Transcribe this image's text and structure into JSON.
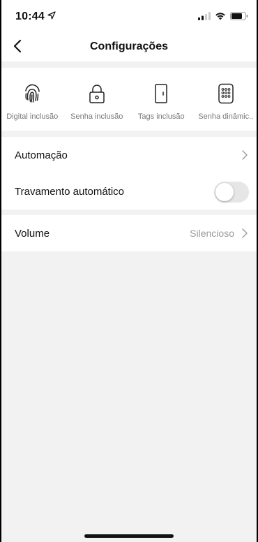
{
  "status_bar": {
    "time": "10:44"
  },
  "header": {
    "title": "Configurações"
  },
  "shortcuts": [
    {
      "label": "Digital inclusão",
      "icon": "fingerprint-icon"
    },
    {
      "label": "Senha inclusão",
      "icon": "padlock-icon"
    },
    {
      "label": "Tags inclusão",
      "icon": "door-icon"
    },
    {
      "label": "Senha dinâmic..",
      "icon": "keypad-icon"
    }
  ],
  "settings": {
    "automation_label": "Automação",
    "auto_lock_label": "Travamento automático",
    "auto_lock_enabled": false,
    "volume_label": "Volume",
    "volume_value": "Silencioso"
  },
  "colors": {
    "background": "#f2f2f2",
    "card": "#ffffff",
    "secondary_text": "#999999"
  }
}
